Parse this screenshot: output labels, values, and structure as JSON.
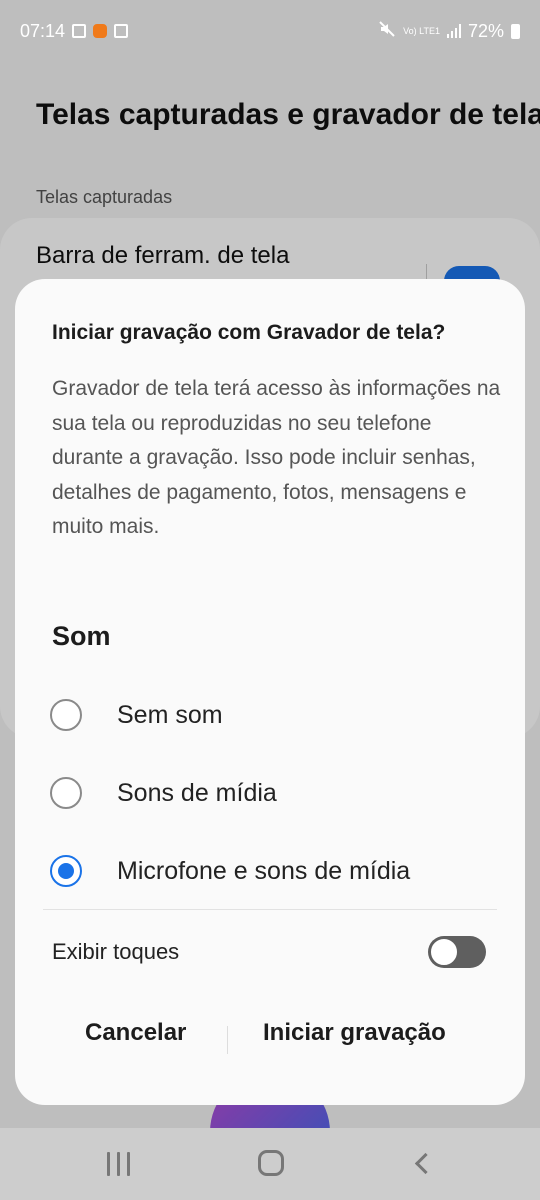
{
  "status_bar": {
    "time": "07:14",
    "network_label": "Vo) LTE1",
    "battery": "72%"
  },
  "background": {
    "title": "Telas capturadas e gravador de tela",
    "section": "Telas capturadas",
    "item": "Barra de ferram. de tela"
  },
  "dialog": {
    "title": "Iniciar gravação com Gravador de tela?",
    "body": "Gravador de tela terá acesso às informações na sua tela ou reproduzidas no seu telefone durante a gravação. Isso pode incluir senhas, detalhes de pagamento, fotos, mensagens e muito mais.",
    "sound_section": "Som",
    "options": [
      {
        "label": "Sem som",
        "selected": false
      },
      {
        "label": "Sons de mídia",
        "selected": false
      },
      {
        "label": "Microfone e sons de mídia",
        "selected": true
      }
    ],
    "show_touches": {
      "label": "Exibir toques",
      "enabled": false
    },
    "cancel_label": "Cancelar",
    "start_label": "Iniciar gravação"
  },
  "colors": {
    "accent": "#1a73e8",
    "toggle_off": "#5f5f5f"
  },
  "icons": [
    "image-icon",
    "app-notification-icon",
    "screenshot-icon",
    "mute-icon",
    "signal-icon",
    "battery-icon",
    "recent-apps-icon",
    "home-icon",
    "back-icon"
  ]
}
